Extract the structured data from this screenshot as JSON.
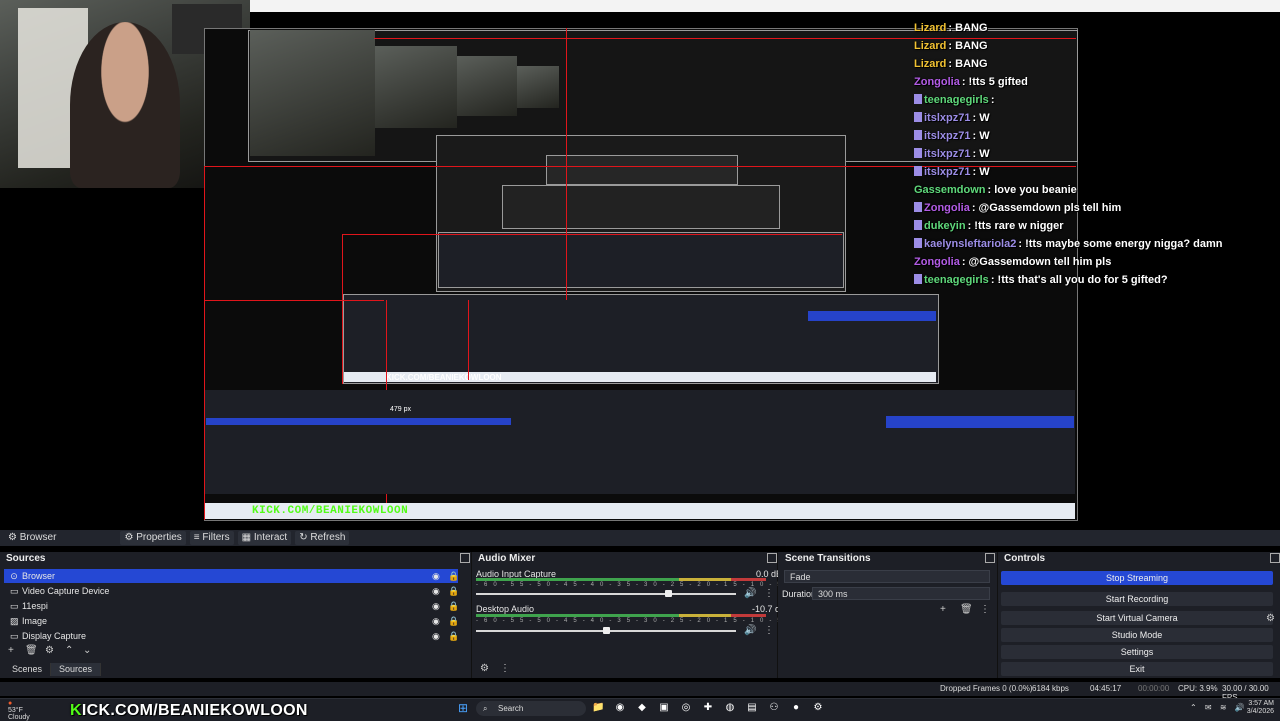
{
  "chat": [
    {
      "user": "Lizard",
      "msg": ": BANG",
      "color": "#f1c232",
      "badge": false
    },
    {
      "user": "Lizard",
      "msg": ": BANG",
      "color": "#f1c232",
      "badge": false
    },
    {
      "user": "Lizard",
      "msg": ": BANG",
      "color": "#f1c232",
      "badge": false
    },
    {
      "user": "Zongolia",
      "msg": ": !tts 5 gifted",
      "color": "#b35ce6",
      "badge": false
    },
    {
      "user": "teenagegirls",
      "msg": ":",
      "color": "#5fd97b",
      "badge": true
    },
    {
      "user": "itslxpz71",
      "msg": ":  W",
      "color": "#9c8de6",
      "badge": true
    },
    {
      "user": "itslxpz71",
      "msg": ":  W",
      "color": "#9c8de6",
      "badge": true
    },
    {
      "user": "itslxpz71",
      "msg": ":  W",
      "color": "#9c8de6",
      "badge": true
    },
    {
      "user": "itslxpz71",
      "msg": ":  W",
      "color": "#9c8de6",
      "badge": true
    },
    {
      "user": "Gassemdown",
      "msg": ": love you beanie",
      "color": "#5fd97b",
      "badge": false
    },
    {
      "user": "Zongolia",
      "msg": ": @Gassemdown pls tell him",
      "color": "#b35ce6",
      "badge": true
    },
    {
      "user": "dukeyin",
      "msg": ": !tts rare w nigger",
      "color": "#5fd97b",
      "badge": true
    },
    {
      "user": "kaelynsleftariola2",
      "msg": ": !tts maybe some energy nigga? damn",
      "color": "#9c8de6",
      "badge": true
    },
    {
      "user": "Zongolia",
      "msg": ": @Gassemdown tell him pls",
      "color": "#b35ce6",
      "badge": false
    },
    {
      "user": "teenagegirls",
      "msg": ": !tts that's all you do for 5 gifted?",
      "color": "#5fd97b",
      "badge": true
    }
  ],
  "inner": {
    "pixel_label": "479 px",
    "kick": "KICK.COM/BEANIEKOWLOON",
    "nested_kick": "KICK.COM/BEANIEKOWLOON"
  },
  "propbar": {
    "source": "Browser",
    "properties": "Properties",
    "filters": "Filters",
    "interact": "Interact",
    "refresh": "Refresh"
  },
  "sources": {
    "title": "Sources",
    "items": [
      "Browser",
      "Video Capture Device",
      "11espi",
      "Image",
      "Display Capture"
    ],
    "tabs": [
      "Scenes",
      "Sources"
    ]
  },
  "mixer": {
    "title": "Audio Mixer",
    "channels": [
      {
        "name": "Audio Input Capture",
        "db": "0.0 dB",
        "level": 0.74
      },
      {
        "name": "Desktop Audio",
        "db": "-10.7 dB",
        "level": 0.5
      }
    ],
    "scale": [
      "-60",
      "-55",
      "-50",
      "-45",
      "-40",
      "-35",
      "-30",
      "-25",
      "-20",
      "-15",
      "-10",
      "-5",
      "0"
    ]
  },
  "transitions": {
    "title": "Scene Transitions",
    "type": "Fade",
    "duration_label": "Duration",
    "duration": "300 ms"
  },
  "controls": {
    "title": "Controls",
    "buttons": [
      "Stop Streaming",
      "Start Recording",
      "Start Virtual Camera",
      "Studio Mode",
      "Settings",
      "Exit"
    ]
  },
  "status": {
    "dropped": "Dropped Frames 0 (0.0%)",
    "kbps": "6184 kbps",
    "stream_time": "04:45:17",
    "rec_time": "00:00:00",
    "cpu": "CPU: 3.9%",
    "fps": "30.00 / 30.00 FPS"
  },
  "taskbar": {
    "weather_temp": "53°F",
    "weather_desc": "Cloudy",
    "search": "Search",
    "time": "3:57 AM",
    "date": "3/4/2026"
  },
  "colors": {
    "accent": "#2548d4",
    "kick_green": "#53fc18",
    "red_outline": "#e0151b"
  }
}
